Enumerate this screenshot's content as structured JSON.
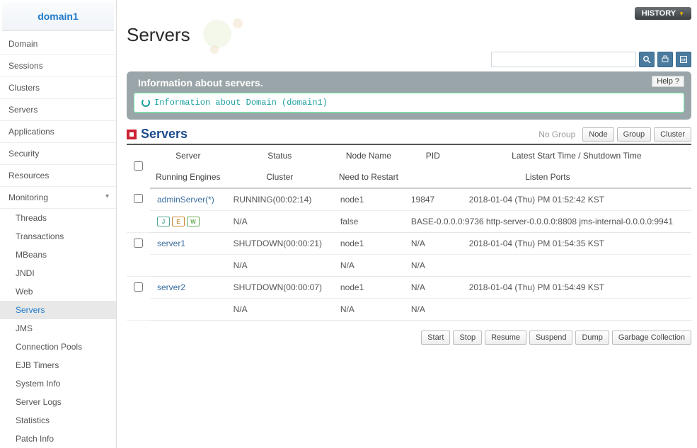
{
  "domain": "domain1",
  "nav": {
    "domain": "Domain",
    "sessions": "Sessions",
    "clusters": "Clusters",
    "servers": "Servers",
    "applications": "Applications",
    "security": "Security",
    "resources": "Resources",
    "monitoring": "Monitoring"
  },
  "mon_sub": {
    "threads": "Threads",
    "transactions": "Transactions",
    "mbeans": "MBeans",
    "jndi": "JNDI",
    "web": "Web",
    "servers": "Servers",
    "jms": "JMS",
    "connpools": "Connection Pools",
    "ejbtimers": "EJB Timers",
    "sysinfo": "System Info",
    "serverlogs": "Server Logs",
    "statistics": "Statistics",
    "patchinfo": "Patch Info"
  },
  "top": {
    "history": "HISTORY",
    "search_placeholder": ""
  },
  "page_title": "Servers",
  "info": {
    "title": "Information about servers.",
    "help": "Help",
    "message": "Information about Domain (domain1)"
  },
  "section": {
    "title": "Servers",
    "no_group": "No Group",
    "node": "Node",
    "group": "Group",
    "cluster": "Cluster"
  },
  "cols": {
    "server": "Server",
    "status": "Status",
    "node": "Node Name",
    "pid": "PID",
    "latest": "Latest Start Time / Shutdown Time",
    "engines": "Running Engines",
    "cluster": "Cluster",
    "restart": "Need to Restart",
    "ports": "Listen Ports"
  },
  "rows": [
    {
      "server": "adminServer(*)",
      "status": "RUNNING(00:02:14)",
      "node": "node1",
      "pid": "19847",
      "latest": "2018-01-04 (Thu) PM 01:52:42 KST",
      "engines_icons": true,
      "cluster": "N/A",
      "restart": "false",
      "ports": "BASE-0.0.0.0:9736 http-server-0.0.0.0:8808 jms-internal-0.0.0.0:9941"
    },
    {
      "server": "server1",
      "status": "SHUTDOWN(00:00:21)",
      "node": "node1",
      "pid": "N/A",
      "latest": "2018-01-04 (Thu) PM 01:54:35 KST",
      "engines_icons": false,
      "cluster": "N/A",
      "restart": "N/A",
      "ports": "N/A"
    },
    {
      "server": "server2",
      "status": "SHUTDOWN(00:00:07)",
      "node": "node1",
      "pid": "N/A",
      "latest": "2018-01-04 (Thu) PM 01:54:49 KST",
      "engines_icons": false,
      "cluster": "N/A",
      "restart": "N/A",
      "ports": "N/A"
    }
  ],
  "actions": {
    "start": "Start",
    "stop": "Stop",
    "resume": "Resume",
    "suspend": "Suspend",
    "dump": "Dump",
    "gc": "Garbage Collection"
  }
}
